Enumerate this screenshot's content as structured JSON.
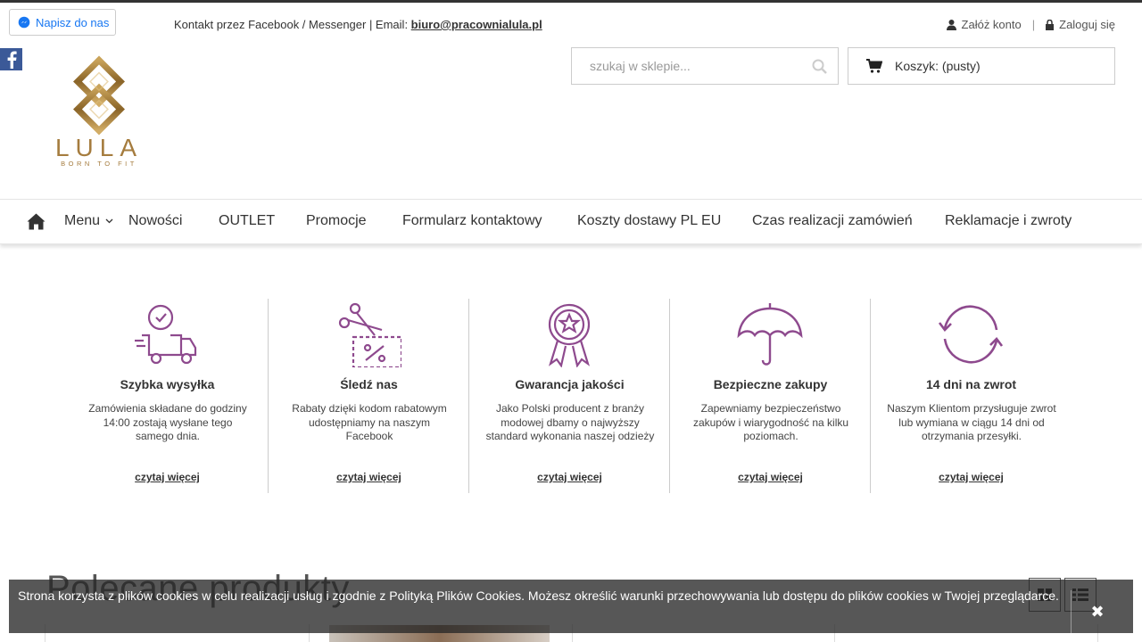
{
  "header": {
    "messenger_button": "Napisz do nas",
    "contact_text": "Kontakt przez Facebook / Messenger | Email: ",
    "contact_email": "biuro@pracownialula.pl",
    "register_label": "Załóż konto",
    "login_label": "Zaloguj się",
    "separator": "|"
  },
  "logo": {
    "wordmark": "LULA",
    "tagline": "BORN TO FIT"
  },
  "search": {
    "placeholder": "szukaj w sklepie..."
  },
  "cart": {
    "label": "Koszyk:",
    "status": "(pusty)"
  },
  "nav": {
    "items": [
      "Menu",
      "Nowości",
      "OUTLET",
      "Promocje",
      "Formularz kontaktowy",
      "Koszty dostawy PL EU",
      "Czas realizacji zamówień",
      "Reklamacje i zwroty"
    ]
  },
  "features": [
    {
      "icon": "delivery-truck-icon",
      "title": "Szybka wysyłka",
      "text": "Zamówienia składane do godziny 14:00 zostają wysłane tego samego dnia.",
      "link": "czytaj więcej"
    },
    {
      "icon": "coupon-scissors-icon",
      "title": "Śledź nas",
      "text": "Rabaty dzięki kodom rabatowym udostępniamy na naszym Facebook",
      "link": "czytaj więcej"
    },
    {
      "icon": "quality-badge-icon",
      "title": "Gwarancja jakości",
      "text": "Jako Polski producent z branży modowej dbamy o najwyższy standard wykonania naszej odzieży",
      "link": "czytaj więcej"
    },
    {
      "icon": "umbrella-icon",
      "title": "Bezpieczne zakupy",
      "text": "Zapewniamy bezpieczeństwo zakupów i wiarygodność na kilku poziomach.",
      "link": "czytaj więcej"
    },
    {
      "icon": "return-arrows-icon",
      "title": "14 dni na zwrot",
      "text": "Naszym Klientom przysługuje zwrot lub wymiana w ciągu 14 dni od otrzymania przesyłki.",
      "link": "czytaj więcej"
    }
  ],
  "section": {
    "title": "Polecane produkty"
  },
  "cookie": {
    "text": "Strona korzysta z plików cookies w celu realizacji usług i zgodnie z Polityką Plików Cookies. Możesz określić warunki przechowywania lub dostępu do plików cookies w Twojej przeglądarce.",
    "close": "✖"
  },
  "colors": {
    "accent_purple": "#8e4a8e",
    "logo_gold": "#a57c3e",
    "messenger_blue": "#1877f2",
    "facebook_blue": "#3b5998"
  }
}
